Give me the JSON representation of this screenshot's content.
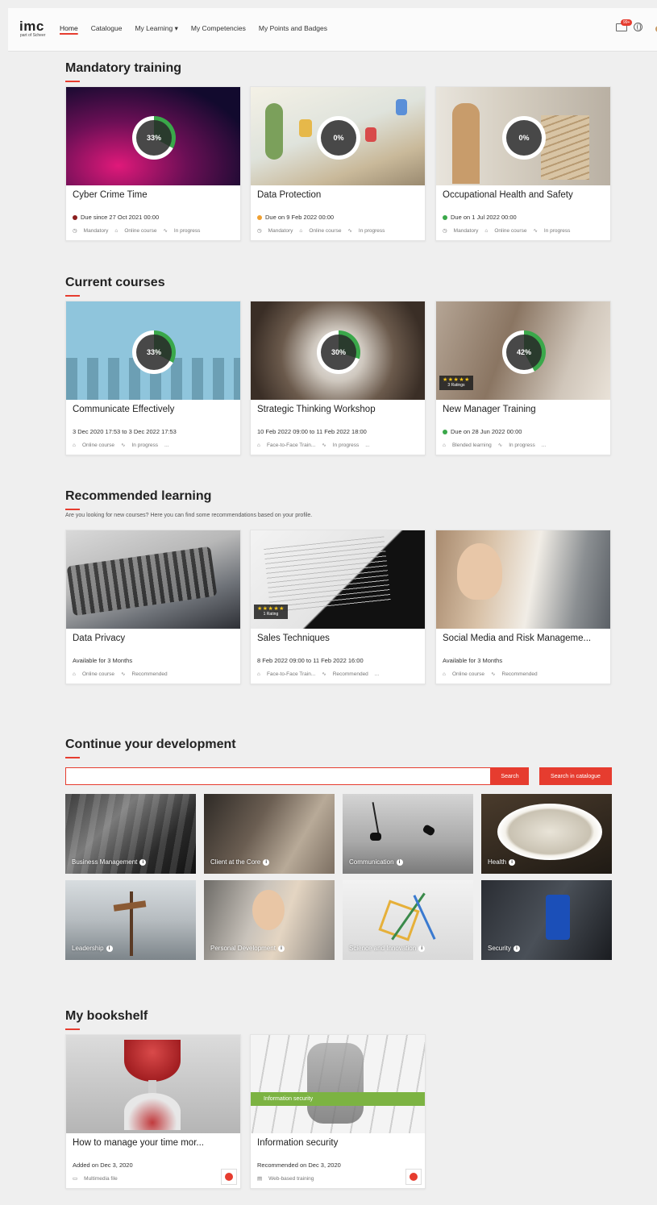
{
  "header": {
    "logo": "imc",
    "logo_sub": "part of Scheer",
    "nav": [
      "Home",
      "Catalogue",
      "My Learning ▾",
      "My Competencies",
      "My Points and Badges"
    ],
    "mail_badge": "99+"
  },
  "mandatory": {
    "title": "Mandatory training",
    "cards": [
      {
        "title": "Cyber Crime Time",
        "progress": "33%",
        "due": "Due since 27 Oct 2021 00:00",
        "dot_color": "#8b1e1e",
        "meta": [
          "Mandatory",
          "Online course",
          "In progress"
        ]
      },
      {
        "title": "Data Protection",
        "progress": "0%",
        "due": "Due on 9 Feb 2022 00:00",
        "dot_color": "#f0a030",
        "meta": [
          "Mandatory",
          "Online course",
          "In progress"
        ]
      },
      {
        "title": "Occupational Health and Safety",
        "progress": "0%",
        "due": "Due on 1 Jul 2022 00:00",
        "dot_color": "#3aa84a",
        "meta": [
          "Mandatory",
          "Online course",
          "In progress"
        ]
      }
    ]
  },
  "current": {
    "title": "Current courses",
    "cards": [
      {
        "title": "Communicate Effectively",
        "progress": "33%",
        "line1": "3 Dec 2020 17:53 to 3 Dec 2022 17:53",
        "meta": [
          "Online course",
          "In progress",
          "..."
        ]
      },
      {
        "title": "Strategic Thinking Workshop",
        "progress": "30%",
        "line1": "10 Feb 2022 09:00 to 11 Feb 2022 18:00",
        "meta": [
          "Face-to-Face Train...",
          "In progress",
          "..."
        ]
      },
      {
        "title": "New Manager Training",
        "progress": "42%",
        "line1": "Due on 28 Jun 2022 00:00",
        "dot_color": "#3aa84a",
        "rating": "3 Ratings",
        "meta": [
          "Blended learning",
          "In progress",
          "..."
        ]
      }
    ]
  },
  "recommended": {
    "title": "Recommended learning",
    "subtitle": "Are you looking for new courses? Here you can find some recommendations based on your profile.",
    "cards": [
      {
        "title": "Data Privacy",
        "line1": "Available for 3 Months",
        "meta": [
          "Online course",
          "Recommended"
        ]
      },
      {
        "title": "Sales Techniques",
        "line1": "8 Feb 2022 09:00 to 11 Feb 2022 16:00",
        "rating": "1 Rating",
        "meta": [
          "Face-to-Face Train...",
          "Recommended",
          "..."
        ]
      },
      {
        "title": "Social Media and Risk Manageme...",
        "line1": "Available for 3 Months",
        "meta": [
          "Online course",
          "Recommended"
        ]
      }
    ]
  },
  "development": {
    "title": "Continue your development",
    "search_button": "Search",
    "catalogue_button": "Search in catalogue",
    "tiles": [
      "Business Management",
      "Client at the Core",
      "Communication",
      "Health",
      "Leadership",
      "Personal Development",
      "Science and Innovation",
      "Security"
    ]
  },
  "bookshelf": {
    "title": "My bookshelf",
    "cards": [
      {
        "title": "How to manage your time mor...",
        "line1": "Added on Dec 3, 2020",
        "meta": [
          "Multimedia file"
        ]
      },
      {
        "title": "Information security",
        "line1": "Recommended on Dec 3, 2020",
        "meta": [
          "Web-based training"
        ],
        "banner": "Information security"
      }
    ]
  },
  "colors": {
    "accent": "#e63c2f",
    "ring": "#3aa84a"
  }
}
